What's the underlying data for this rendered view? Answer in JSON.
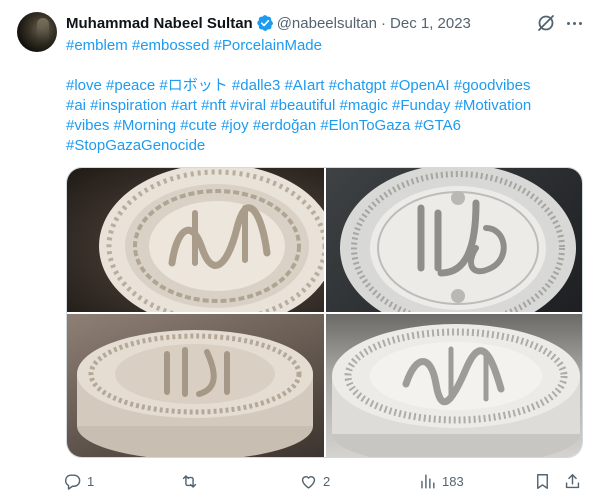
{
  "author": {
    "name": "Muhammad Nabeel Sultan",
    "handle": "@nabeelsultan",
    "separator": "·",
    "date": "Dec 1, 2023"
  },
  "tweet_text": {
    "line1": "#emblem  #embossed #PorcelainMade",
    "line2": " #love #peace #ロボット #dalle3 #AIart #chatgpt #OpenAI #goodvibes",
    "line3": "#ai #inspiration #art #nft #viral #beautiful #magic #Funday #Motivation",
    "line4": "#vibes #Morning #cute #joy #erdoğan #ElonToGaza #GTA6",
    "line5": "#StopGazaGenocide"
  },
  "media": [
    {
      "icon": "porcelain-emblem-image"
    },
    {
      "icon": "porcelain-emblem-image"
    },
    {
      "icon": "porcelain-emblem-image"
    },
    {
      "icon": "porcelain-emblem-image"
    }
  ],
  "actions": {
    "reply_count": "1",
    "retweet_count": "",
    "like_count": "2",
    "views_count": "183"
  },
  "colors": {
    "link": "#1d9bf0",
    "verified": "#1d9bf0",
    "secondary_text": "#536471",
    "border": "#cfd9de"
  }
}
